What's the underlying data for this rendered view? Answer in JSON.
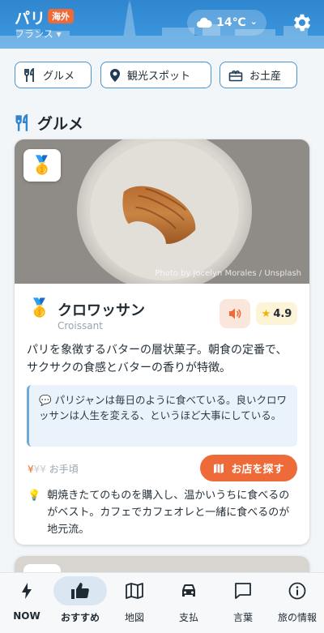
{
  "header": {
    "city": "パリ",
    "badge": "海外",
    "country": "フランス",
    "country_chevron": "▾",
    "weather_icon": "cloud-icon",
    "temperature": "14℃",
    "temp_chevron": "⌄"
  },
  "categories": [
    {
      "label": "グルメ",
      "icon": "fork-knife-icon"
    },
    {
      "label": "観光スポット",
      "icon": "location-pin-icon"
    },
    {
      "label": "お土産",
      "icon": "gift-icon"
    }
  ],
  "section": {
    "title": "グルメ",
    "icon": "fork-knife-icon"
  },
  "card": {
    "medal": "🥇",
    "photo_credit": "Photo by Jocelyn Morales / Unsplash",
    "rank_medal": "🥇",
    "name": "クロワッサン",
    "name_en": "Croissant",
    "rating_star": "★",
    "rating": "4.9",
    "description": "パリを象徴するバターの層状菓子。朝食の定番で、サクサクの食感とバターの香りが特徴。",
    "quote_icon": "💬",
    "quote": "パリジャンは毎日のように食べている。良いクロワッサンは人生を変える、というほど大事にしている。",
    "price_active": "¥",
    "price_inactive": "¥¥",
    "price_label": "お手頃",
    "shop_button": "お店を探す",
    "tip_icon": "💡",
    "tip": "朝焼きたてのものを購入し、温かいうちに食べるのがベスト。カフェでカフェオレと一緒に食べるのが地元流。"
  },
  "nav": [
    {
      "label": "NOW",
      "icon": "bolt-icon",
      "active": false
    },
    {
      "label": "おすすめ",
      "icon": "thumbs-up-icon",
      "active": true
    },
    {
      "label": "地図",
      "icon": "map-icon",
      "active": false
    },
    {
      "label": "支払",
      "icon": "car-icon",
      "active": false
    },
    {
      "label": "言葉",
      "icon": "chat-bubble-icon",
      "active": false
    },
    {
      "label": "旅の情報",
      "icon": "info-icon",
      "active": false
    }
  ],
  "colors": {
    "primary": "#3f9ae0",
    "accent": "#ee6a38",
    "outline": "#4a93cf"
  }
}
